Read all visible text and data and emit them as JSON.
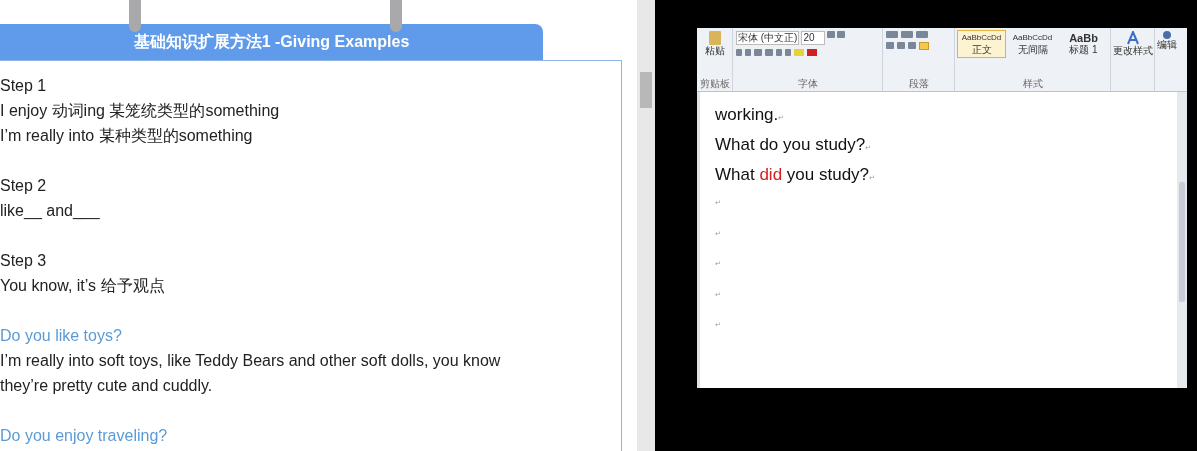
{
  "lesson": {
    "title": "基础知识扩展方法1 -Giving Examples",
    "blocks": [
      {
        "lines": [
          {
            "kind": "text",
            "text": "Step 1"
          },
          {
            "kind": "text",
            "text": "I enjoy 动词ing 某笼统类型的something"
          },
          {
            "kind": "text",
            "text": "I’m really into 某种类型的something"
          }
        ]
      },
      {
        "lines": [
          {
            "kind": "text",
            "text": "Step 2"
          },
          {
            "kind": "text",
            "text": "like__ and___"
          }
        ]
      },
      {
        "lines": [
          {
            "kind": "text",
            "text": "Step 3"
          },
          {
            "kind": "text",
            "text": "You know, it’s 给予观点"
          }
        ]
      },
      {
        "lines": [
          {
            "kind": "question",
            "text": "Do you like toys?"
          },
          {
            "kind": "text",
            "text": "I’m really into soft toys, like Teddy Bears and other soft dolls, you know"
          },
          {
            "kind": "text",
            "text": "they’re pretty cute and cuddly."
          }
        ]
      },
      {
        "lines": [
          {
            "kind": "question",
            "text": "Do you enjoy traveling?"
          }
        ]
      }
    ]
  },
  "word": {
    "ribbon": {
      "paste": "粘贴",
      "font_name": "宋体 (中文正)",
      "font_size": "20",
      "groups": [
        "剪贴板",
        "字体",
        "段落",
        "样式"
      ],
      "styles": [
        {
          "sample": "AaBbCcDd",
          "name": "正文",
          "selected": true
        },
        {
          "sample": "AaBbCcDd",
          "name": "无间隔",
          "selected": false
        },
        {
          "sample": "AaBb",
          "name": "标题 1",
          "selected": false
        }
      ],
      "change_styles": "更改样式",
      "editing": "编辑"
    },
    "lines": [
      {
        "segments": [
          {
            "text": "working.",
            "emphasis": false
          }
        ],
        "mark": "↵"
      },
      {
        "segments": [
          {
            "text": "What do you study?",
            "emphasis": false
          }
        ],
        "mark": "↵"
      },
      {
        "segments": [
          {
            "text": "What ",
            "emphasis": false
          },
          {
            "text": "did",
            "emphasis": true
          },
          {
            "text": " you study?",
            "emphasis": false
          }
        ],
        "mark": "↵"
      },
      {
        "mark": "↵"
      },
      {
        "mark": "↵"
      },
      {
        "mark": "↵"
      },
      {
        "mark": "↵"
      },
      {
        "mark": "↵"
      }
    ]
  }
}
